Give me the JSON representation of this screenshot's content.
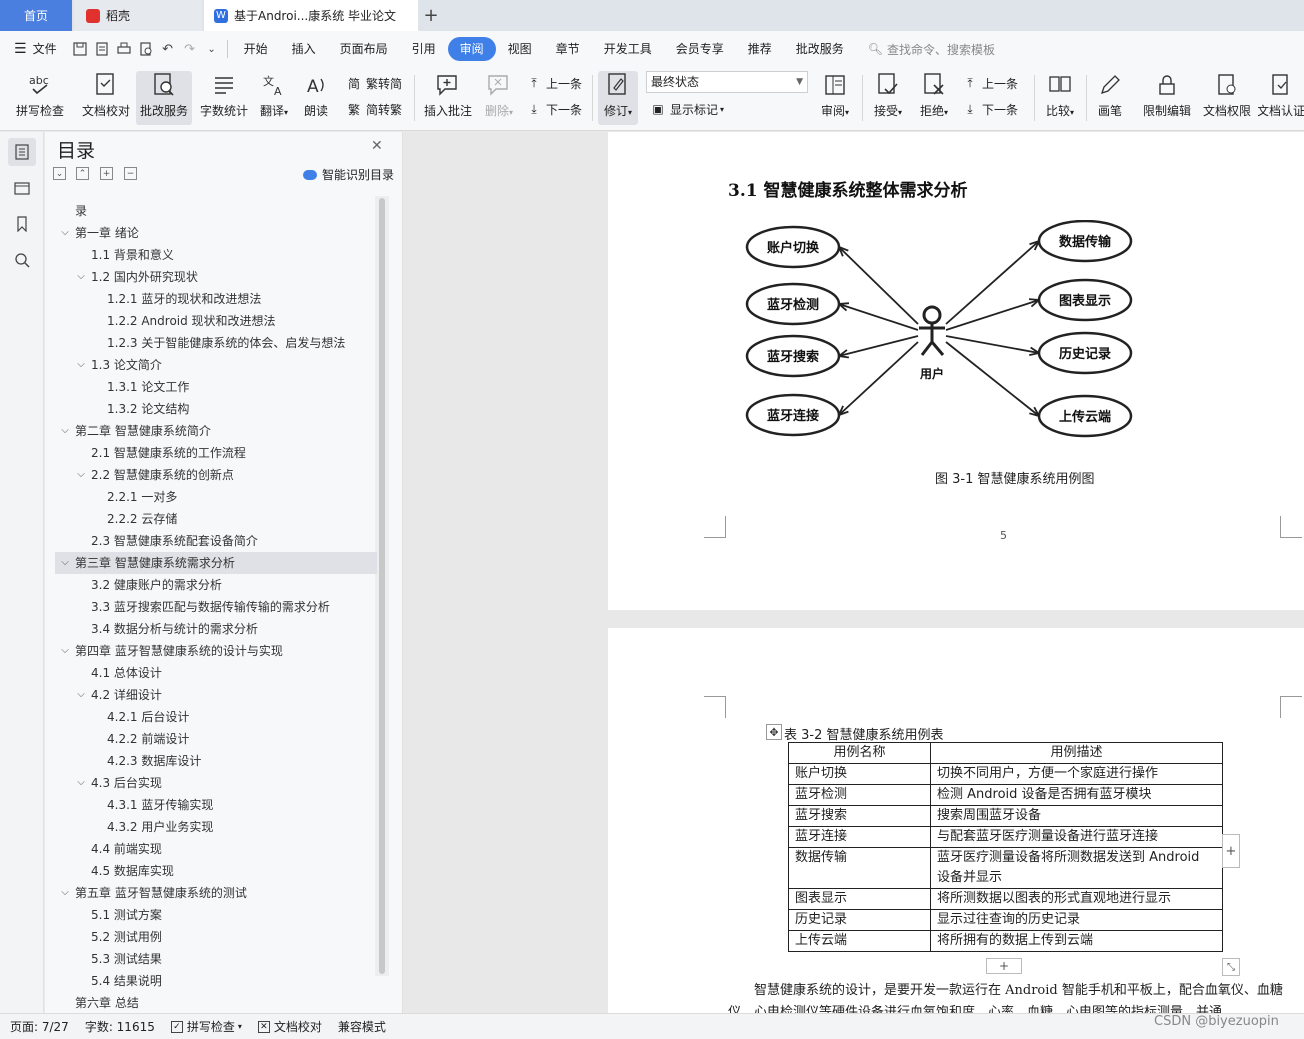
{
  "tabs": {
    "home": "首页",
    "daoke": "稻壳",
    "doc": "基于Androi...康系统 毕业论文",
    "add": "+"
  },
  "menu": {
    "file": "文件",
    "items": [
      "开始",
      "插入",
      "页面布局",
      "引用",
      "审阅",
      "视图",
      "章节",
      "开发工具",
      "会员专享",
      "推荐",
      "批改服务"
    ],
    "active": "审阅",
    "search": "查找命令、搜索模板"
  },
  "ribbon": {
    "spell": "拼写检查",
    "proof": "文档校对",
    "correct": "批改服务",
    "wordcount": "字数统计",
    "translate": "翻译",
    "read": "朗读",
    "to_trad": "繁转简",
    "to_simp": "简转繁",
    "insert_comment": "插入批注",
    "delete": "删除",
    "prev": "上一条",
    "next": "下一条",
    "revise": "修订",
    "status": "最终状态",
    "show_marks": "显示标记",
    "review": "审阅",
    "accept": "接受",
    "reject": "拒绝",
    "prev2": "上一条",
    "next2": "下一条",
    "compare": "比较",
    "pen": "画笔",
    "restrict": "限制编辑",
    "rights": "文档权限",
    "auth": "文档认证"
  },
  "toc": {
    "title": "目录",
    "smart": "智能识别目录",
    "items": [
      {
        "text": "录",
        "level": 0,
        "arrow": false
      },
      {
        "text": "第一章  绪论",
        "level": 0,
        "arrow": true
      },
      {
        "text": "1.1 背景和意义",
        "level": 1,
        "arrow": false
      },
      {
        "text": "1.2 国内外研究现状",
        "level": 1,
        "arrow": true
      },
      {
        "text": "1.2.1  蓝牙的现状和改进想法",
        "level": 2,
        "arrow": false
      },
      {
        "text": "1.2.2 Android 现状和改进想法",
        "level": 2,
        "arrow": false
      },
      {
        "text": "1.2.3  关于智能健康系统的体会、启发与想法",
        "level": 2,
        "arrow": false
      },
      {
        "text": "1.3 论文简介",
        "level": 1,
        "arrow": true
      },
      {
        "text": "1.3.1 论文工作",
        "level": 2,
        "arrow": false
      },
      {
        "text": "1.3.2 论文结构",
        "level": 2,
        "arrow": false
      },
      {
        "text": "第二章  智慧健康系统简介",
        "level": 0,
        "arrow": true
      },
      {
        "text": "2.1 智慧健康系统的工作流程",
        "level": 1,
        "arrow": false
      },
      {
        "text": "2.2 智慧健康系统的创新点",
        "level": 1,
        "arrow": true
      },
      {
        "text": "2.2.1 一对多",
        "level": 2,
        "arrow": false
      },
      {
        "text": "2.2.2 云存储",
        "level": 2,
        "arrow": false
      },
      {
        "text": "2.3 智慧健康系统配套设备简介",
        "level": 1,
        "arrow": false
      },
      {
        "text": "第三章  智慧健康系统需求分析",
        "level": 0,
        "arrow": true,
        "selected": true
      },
      {
        "text": "3.2 健康账户的需求分析",
        "level": 1,
        "arrow": false
      },
      {
        "text": "3.3 蓝牙搜索匹配与数据传输传输的需求分析",
        "level": 1,
        "arrow": false
      },
      {
        "text": "3.4 数据分析与统计的需求分析",
        "level": 1,
        "arrow": false
      },
      {
        "text": "第四章  蓝牙智慧健康系统的设计与实现",
        "level": 0,
        "arrow": true
      },
      {
        "text": "4.1 总体设计",
        "level": 1,
        "arrow": false
      },
      {
        "text": "4.2 详细设计",
        "level": 1,
        "arrow": true
      },
      {
        "text": "4.2.1 后台设计",
        "level": 2,
        "arrow": false
      },
      {
        "text": "4.2.2 前端设计",
        "level": 2,
        "arrow": false
      },
      {
        "text": "4.2.3 数据库设计",
        "level": 2,
        "arrow": false
      },
      {
        "text": "4.3 后台实现",
        "level": 1,
        "arrow": true
      },
      {
        "text": "4.3.1 蓝牙传输实现",
        "level": 2,
        "arrow": false
      },
      {
        "text": "4.3.2 用户业务实现",
        "level": 2,
        "arrow": false
      },
      {
        "text": "4.4 前端实现",
        "level": 1,
        "arrow": false
      },
      {
        "text": "4.5 数据库实现",
        "level": 1,
        "arrow": false
      },
      {
        "text": "第五章  蓝牙智慧健康系统的测试",
        "level": 0,
        "arrow": true
      },
      {
        "text": "5.1 测试方案",
        "level": 1,
        "arrow": false
      },
      {
        "text": "5.2 测试用例",
        "level": 1,
        "arrow": false
      },
      {
        "text": "5.3 测试结果",
        "level": 1,
        "arrow": false
      },
      {
        "text": "5.4 结果说明",
        "level": 1,
        "arrow": false
      },
      {
        "text": "第六章  总结",
        "level": 0,
        "arrow": false
      }
    ]
  },
  "page1": {
    "heading": "3.1 智慧健康系统整体需求分析",
    "diagram": {
      "actor": "用户",
      "left": [
        "账户切换",
        "蓝牙检测",
        "蓝牙搜索",
        "蓝牙连接"
      ],
      "right": [
        "数据传输",
        "图表显示",
        "历史记录",
        "上传云端"
      ]
    },
    "caption": "图 3-1 智慧健康系统用例图",
    "page_number": "5"
  },
  "page2": {
    "table_caption": "表 3-2 智慧健康系统用例表",
    "table": {
      "headers": [
        "用例名称",
        "用例描述"
      ],
      "rows": [
        [
          "账户切换",
          "切换不同用户，方便一个家庭进行操作"
        ],
        [
          "蓝牙检测",
          "检测 Android 设备是否拥有蓝牙模块"
        ],
        [
          "蓝牙搜索",
          "搜索周围蓝牙设备"
        ],
        [
          "蓝牙连接",
          "与配套蓝牙医疗测量设备进行蓝牙连接"
        ],
        [
          "数据传输",
          "蓝牙医疗测量设备将所测数据发送到 Android 设备并显示"
        ],
        [
          "图表显示",
          "将所测数据以图表的形式直观地进行显示"
        ],
        [
          "历史记录",
          "显示过往查询的历史记录"
        ],
        [
          "上传云端",
          "将所拥有的数据上传到云端"
        ]
      ]
    },
    "paragraph": "智慧健康系统的设计，是要开发一款运行在 Android 智能手机和平板上，配合血氧仪、血糖仪、心电检测仪等硬件设备进行血氧饱和度、心率、血糖、心电图等的指标测量，并通"
  },
  "status": {
    "page": "页面: 7/27",
    "words": "字数: 11615",
    "spell": "拼写检查",
    "proof": "文档校对",
    "compat": "兼容模式"
  },
  "watermark": "CSDN @biyezuopin",
  "colors": {
    "accent": "#3f7fe8",
    "home_tab": "#4a7fe0"
  }
}
